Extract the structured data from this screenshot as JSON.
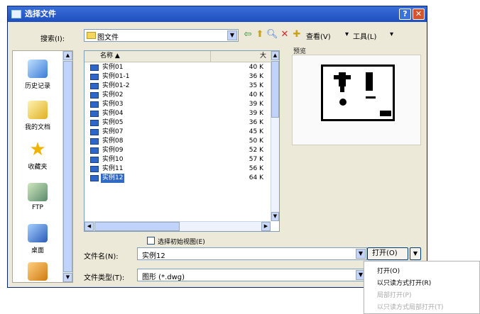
{
  "window": {
    "title": "选择文件",
    "help_btn": "?",
    "close_btn": "✕"
  },
  "toolbar": {
    "lookin_label": "搜索(I):",
    "lookin_value": "图文件",
    "views_label": "查看(V)",
    "tools_label": "工具(L)"
  },
  "places": [
    {
      "label": "历史记录",
      "icon": "history-icon"
    },
    {
      "label": "我的文档",
      "icon": "my-documents-icon"
    },
    {
      "label": "收藏夹",
      "icon": "favorites-icon"
    },
    {
      "label": "FTP",
      "icon": "ftp-icon"
    },
    {
      "label": "桌面",
      "icon": "desktop-icon"
    },
    {
      "label": "",
      "icon": "buzzsaw-icon"
    }
  ],
  "file_list": {
    "headers": {
      "name": "名称",
      "size": "大"
    },
    "rows": [
      {
        "name": "实例01",
        "size": "40 K"
      },
      {
        "name": "实例01-1",
        "size": "36 K"
      },
      {
        "name": "实例01-2",
        "size": "35 K"
      },
      {
        "name": "实例02",
        "size": "40 K"
      },
      {
        "name": "实例03",
        "size": "39 K"
      },
      {
        "name": "实例04",
        "size": "39 K"
      },
      {
        "name": "实例05",
        "size": "36 K"
      },
      {
        "name": "实例07",
        "size": "45 K"
      },
      {
        "name": "实例08",
        "size": "50 K"
      },
      {
        "name": "实例09",
        "size": "52 K"
      },
      {
        "name": "实例10",
        "size": "57 K"
      },
      {
        "name": "实例11",
        "size": "56 K"
      },
      {
        "name": "实例12",
        "size": "64 K"
      }
    ],
    "selected_index": 12
  },
  "preview": {
    "label": "预览"
  },
  "options": {
    "initial_view_label": "选择初始视图(E)"
  },
  "filename": {
    "label": "文件名(N):",
    "value": "实例12"
  },
  "filetype": {
    "label": "文件类型(T):",
    "value": "图形 (*.dwg)"
  },
  "open_button": {
    "label": "打开(O)",
    "dropdown": "▼"
  },
  "open_menu": {
    "items": [
      {
        "label": "打开(O)",
        "enabled": true
      },
      {
        "label": "以只读方式打开(R)",
        "enabled": true
      },
      {
        "label": "局部打开(P)",
        "enabled": false
      },
      {
        "label": "以只读方式局部打开(T)",
        "enabled": false
      }
    ]
  },
  "colors": {
    "title_bar": "#1d4fbf",
    "selection": "#316ac5",
    "dialog_bg": "#ece9d8"
  }
}
